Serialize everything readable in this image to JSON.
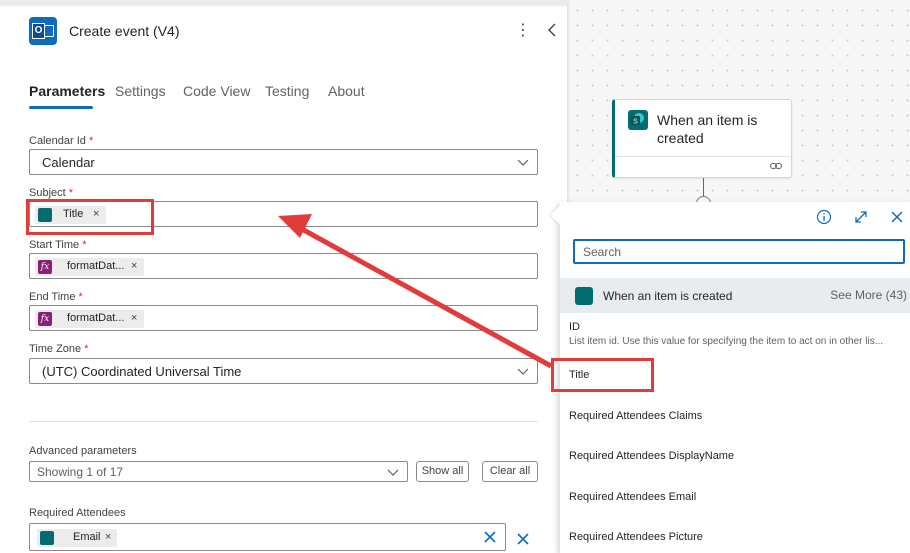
{
  "panel": {
    "title": "Create event (V4)",
    "more_label": "⋮"
  },
  "tabs": [
    "Parameters",
    "Settings",
    "Code View",
    "Testing",
    "About"
  ],
  "fields": {
    "calendar": {
      "label": "Calendar Id",
      "req": "*",
      "value": "Calendar"
    },
    "subject": {
      "label": "Subject",
      "req": "*",
      "token": "Title"
    },
    "start": {
      "label": "Start Time",
      "req": "*",
      "token": "formatDat..."
    },
    "end": {
      "label": "End Time",
      "req": "*",
      "token": "formatDat..."
    },
    "timezone": {
      "label": "Time Zone",
      "req": "*",
      "value": "(UTC) Coordinated Universal Time"
    }
  },
  "advanced": {
    "label": "Advanced parameters",
    "showing": "Showing 1 of 17",
    "show_all": "Show all",
    "clear_all": "Clear all"
  },
  "attendees": {
    "label": "Required Attendees",
    "token": "Email"
  },
  "token_close": "×",
  "canvas": {
    "trigger_title": "When an item is created"
  },
  "popup": {
    "search_placeholder": "Search",
    "group_title": "When an item is created",
    "see_more": "See More (43)",
    "items": [
      {
        "title": "ID",
        "desc": "List item id. Use this value for specifying the item to act on in other lis..."
      },
      {
        "title": "Title"
      },
      {
        "title": "Required Attendees Claims"
      },
      {
        "title": "Required Attendees DisplayName"
      },
      {
        "title": "Required Attendees Email"
      },
      {
        "title": "Required Attendees Picture"
      }
    ]
  },
  "colors": {
    "accent": "#0f6cbd",
    "sharepoint": "#036c70",
    "expression": "#8a1f77",
    "annotation": "#e23b3b"
  }
}
